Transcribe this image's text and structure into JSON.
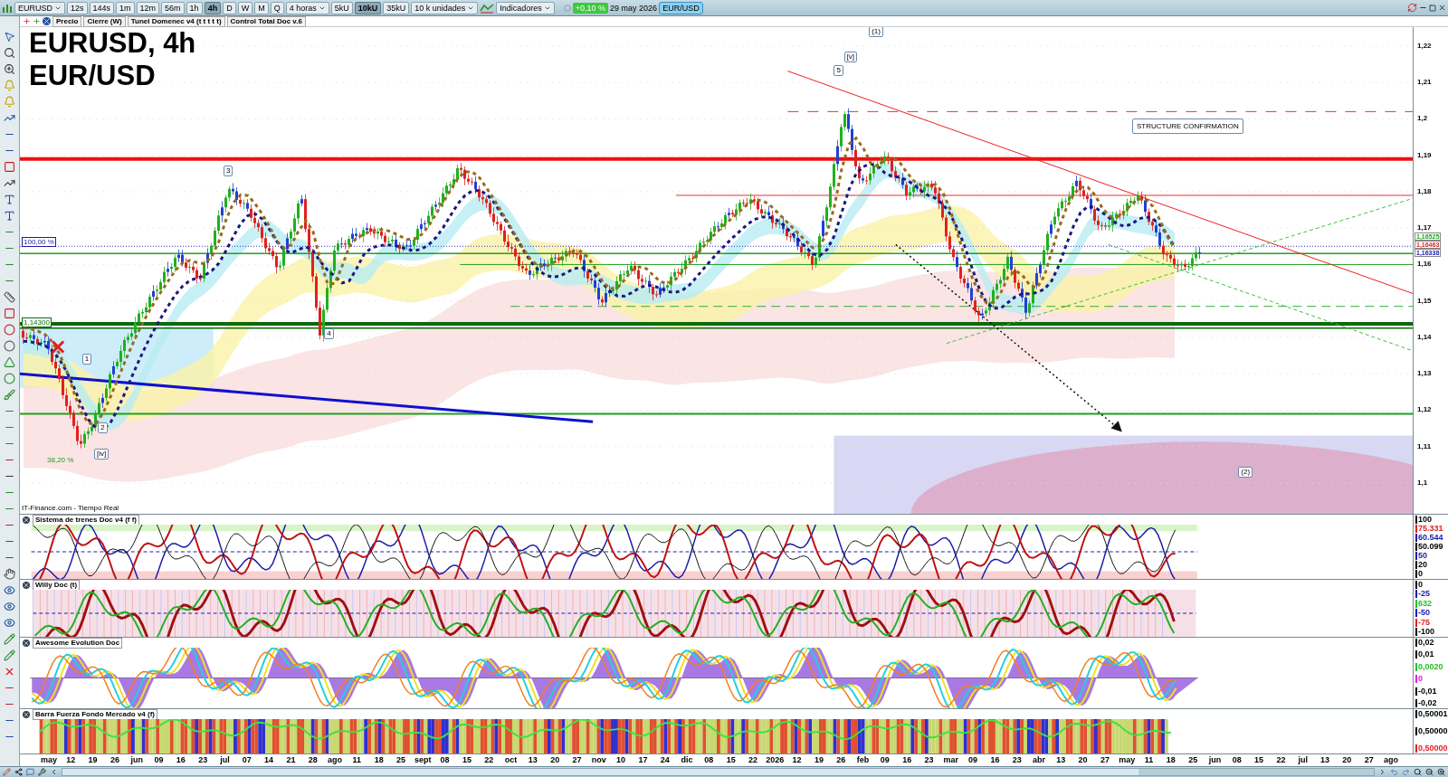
{
  "toolbar": {
    "symbol": "EURUSD",
    "timeframes": [
      {
        "label": "12s",
        "selected": false
      },
      {
        "label": "144s",
        "selected": false
      },
      {
        "label": "1m",
        "selected": false
      },
      {
        "label": "12m",
        "selected": false
      },
      {
        "label": "56m",
        "selected": false
      },
      {
        "label": "1h",
        "selected": false
      },
      {
        "label": "4h",
        "selected": true
      },
      {
        "label": "D",
        "selected": false
      },
      {
        "label": "W",
        "selected": false
      },
      {
        "label": "M",
        "selected": false
      },
      {
        "label": "Q",
        "selected": false
      }
    ],
    "period": "4 horas",
    "units": [
      {
        "label": "5kU",
        "selected": false
      },
      {
        "label": "10kU",
        "selected": true
      },
      {
        "label": "35kU",
        "selected": false
      }
    ],
    "units_select": "10 k unidades",
    "indicators": "Indicadores",
    "change": "+0,10 %",
    "date": "29 may 2026",
    "pair": "EUR/USD"
  },
  "legend": [
    "Precio",
    "Cierre (W)",
    "Tunel Domenec v4 (t t t t t)",
    "Control Total Doc v.6"
  ],
  "chart": {
    "title": "EURUSD, 4h",
    "subtitle": "EUR/USD",
    "source": "IT-Finance.com - Tiempo Real",
    "note": "STRUCTURE CONFIRMATION",
    "wave_labels": [
      "(1)",
      "[v]",
      "5",
      "3",
      "4",
      "1",
      "2",
      "[iv]",
      "(2)"
    ],
    "level_tags": [
      "100,00 %",
      "1,14300",
      "38,20 %"
    ],
    "price_ticks": [
      "1,22",
      "1,21",
      "1,2",
      "1,19",
      "1,18",
      "1,17",
      "1,16",
      "1,15",
      "1,14",
      "1,13",
      "1,12",
      "1,11",
      "1,1"
    ],
    "price_tags": [
      {
        "text": "1,16525",
        "color": "#22a022"
      },
      {
        "text": "1,16463",
        "color": "#e02020"
      },
      {
        "text": "1,16338",
        "color": "#1a1aa8"
      }
    ]
  },
  "panes": [
    {
      "title": "Sistema de trenes Doc v4 (f f)",
      "ticks": [
        {
          "text": "100",
          "color": "#000000"
        },
        {
          "text": "75.331",
          "color": "#e02020"
        },
        {
          "text": "60.544",
          "color": "#1a1aa8"
        },
        {
          "text": "50.099",
          "color": "#000000"
        },
        {
          "text": "50",
          "color": "#1a1aa8"
        },
        {
          "text": "20",
          "color": "#000000"
        },
        {
          "text": "0",
          "color": "#000000"
        }
      ]
    },
    {
      "title": "Willy Doc (t)",
      "ticks": [
        {
          "text": "0",
          "color": "#000000"
        },
        {
          "text": "-25",
          "color": "#1a1aa8"
        },
        {
          "text": "632",
          "color": "#22c022"
        },
        {
          "text": "-50",
          "color": "#1a1aa8"
        },
        {
          "text": "-75",
          "color": "#e02020"
        },
        {
          "text": "-100",
          "color": "#000000"
        }
      ]
    },
    {
      "title": "Awesome Evolution Doc",
      "ticks": [
        {
          "text": "0,02",
          "color": "#000000"
        },
        {
          "text": "0,01",
          "color": "#000000"
        },
        {
          "text": "0,0020",
          "color": "#22c022"
        },
        {
          "text": "0",
          "color": "#e020e0"
        },
        {
          "text": "-0,01",
          "color": "#000000"
        },
        {
          "text": "-0,02",
          "color": "#000000"
        }
      ]
    },
    {
      "title": "Barra Fuerza Fondo Mercado v4 (f)",
      "ticks": [
        {
          "text": "0,50001",
          "color": "#000000"
        },
        {
          "text": "0,50000",
          "color": "#000000"
        },
        {
          "text": "0,50000",
          "color": "#e02020"
        }
      ]
    }
  ],
  "dates": [
    "may",
    "12",
    "19",
    "26",
    "jun",
    "09",
    "16",
    "23",
    "jul",
    "07",
    "14",
    "21",
    "28",
    "ago",
    "11",
    "18",
    "25",
    "sept",
    "08",
    "15",
    "22",
    "oct",
    "13",
    "20",
    "27",
    "nov",
    "10",
    "17",
    "24",
    "dic",
    "08",
    "15",
    "22",
    "2026",
    "12",
    "19",
    "26",
    "feb",
    "09",
    "16",
    "23",
    "mar",
    "09",
    "16",
    "23",
    "abr",
    "13",
    "20",
    "27",
    "may",
    "11",
    "18",
    "25",
    "jun",
    "08",
    "15",
    "22",
    "jul",
    "13",
    "20",
    "27",
    "ago"
  ]
}
